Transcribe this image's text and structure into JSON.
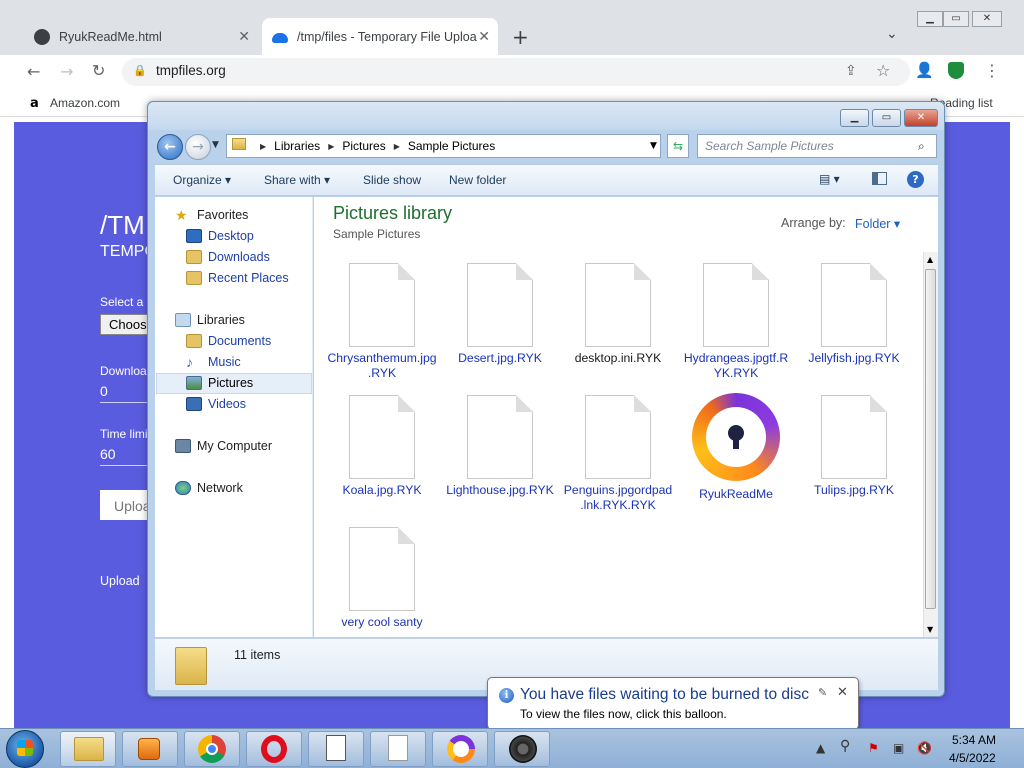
{
  "browser": {
    "tabs": [
      {
        "title": "RyukReadMe.html",
        "close": "✕"
      },
      {
        "title": "/tmp/files - Temporary File Uploa",
        "close": "✕"
      }
    ],
    "new_tab": "+",
    "url": "tmpfiles.org",
    "bookmarks": {
      "amazon": "Amazon.com",
      "reading_list": "Reading list"
    },
    "page": {
      "heading": "/TM",
      "subheading": "TEMPO",
      "select_label": "Select a",
      "choose_btn": "Choos",
      "downloads_label": "Downloa",
      "downloads_value": "0",
      "time_label": "Time limi",
      "time_value": "60",
      "upload_btn": "Uploa",
      "upload_link": "Upload"
    }
  },
  "explorer": {
    "breadcrumbs": [
      "Libraries",
      "Pictures",
      "Sample Pictures"
    ],
    "search_placeholder": "Search Sample Pictures",
    "commands": {
      "organize": "Organize ▾",
      "share": "Share with ▾",
      "slideshow": "Slide show",
      "newfolder": "New folder"
    },
    "nav": {
      "favorites": "Favorites",
      "desktop": "Desktop",
      "downloads": "Downloads",
      "recent": "Recent Places",
      "libraries": "Libraries",
      "documents": "Documents",
      "music": "Music",
      "pictures": "Pictures",
      "videos": "Videos",
      "computer": "My Computer",
      "network": "Network"
    },
    "library_title": "Pictures library",
    "library_sub": "Sample Pictures",
    "arrange_label": "Arrange by:",
    "arrange_value": "Folder ▾",
    "files": [
      "Chrysanthemum.jpg.RYK",
      "Desert.jpg.RYK",
      "desktop.ini.RYK",
      "Hydrangeas.jpgtf.RYK.RYK",
      "Jellyfish.jpg.RYK",
      "Koala.jpg.RYK",
      "Lighthouse.jpg.RYK",
      "Penguins.jpgordpad.lnk.RYK.RYK",
      "RyukReadMe",
      "Tulips.jpg.RYK",
      "very cool santy"
    ],
    "items_count": "11 items"
  },
  "balloon": {
    "title": "You have files waiting to be burned to disc",
    "text": "To view the files now, click this balloon."
  },
  "taskbar": {
    "time": "5:34 AM",
    "date": "4/5/2022"
  }
}
